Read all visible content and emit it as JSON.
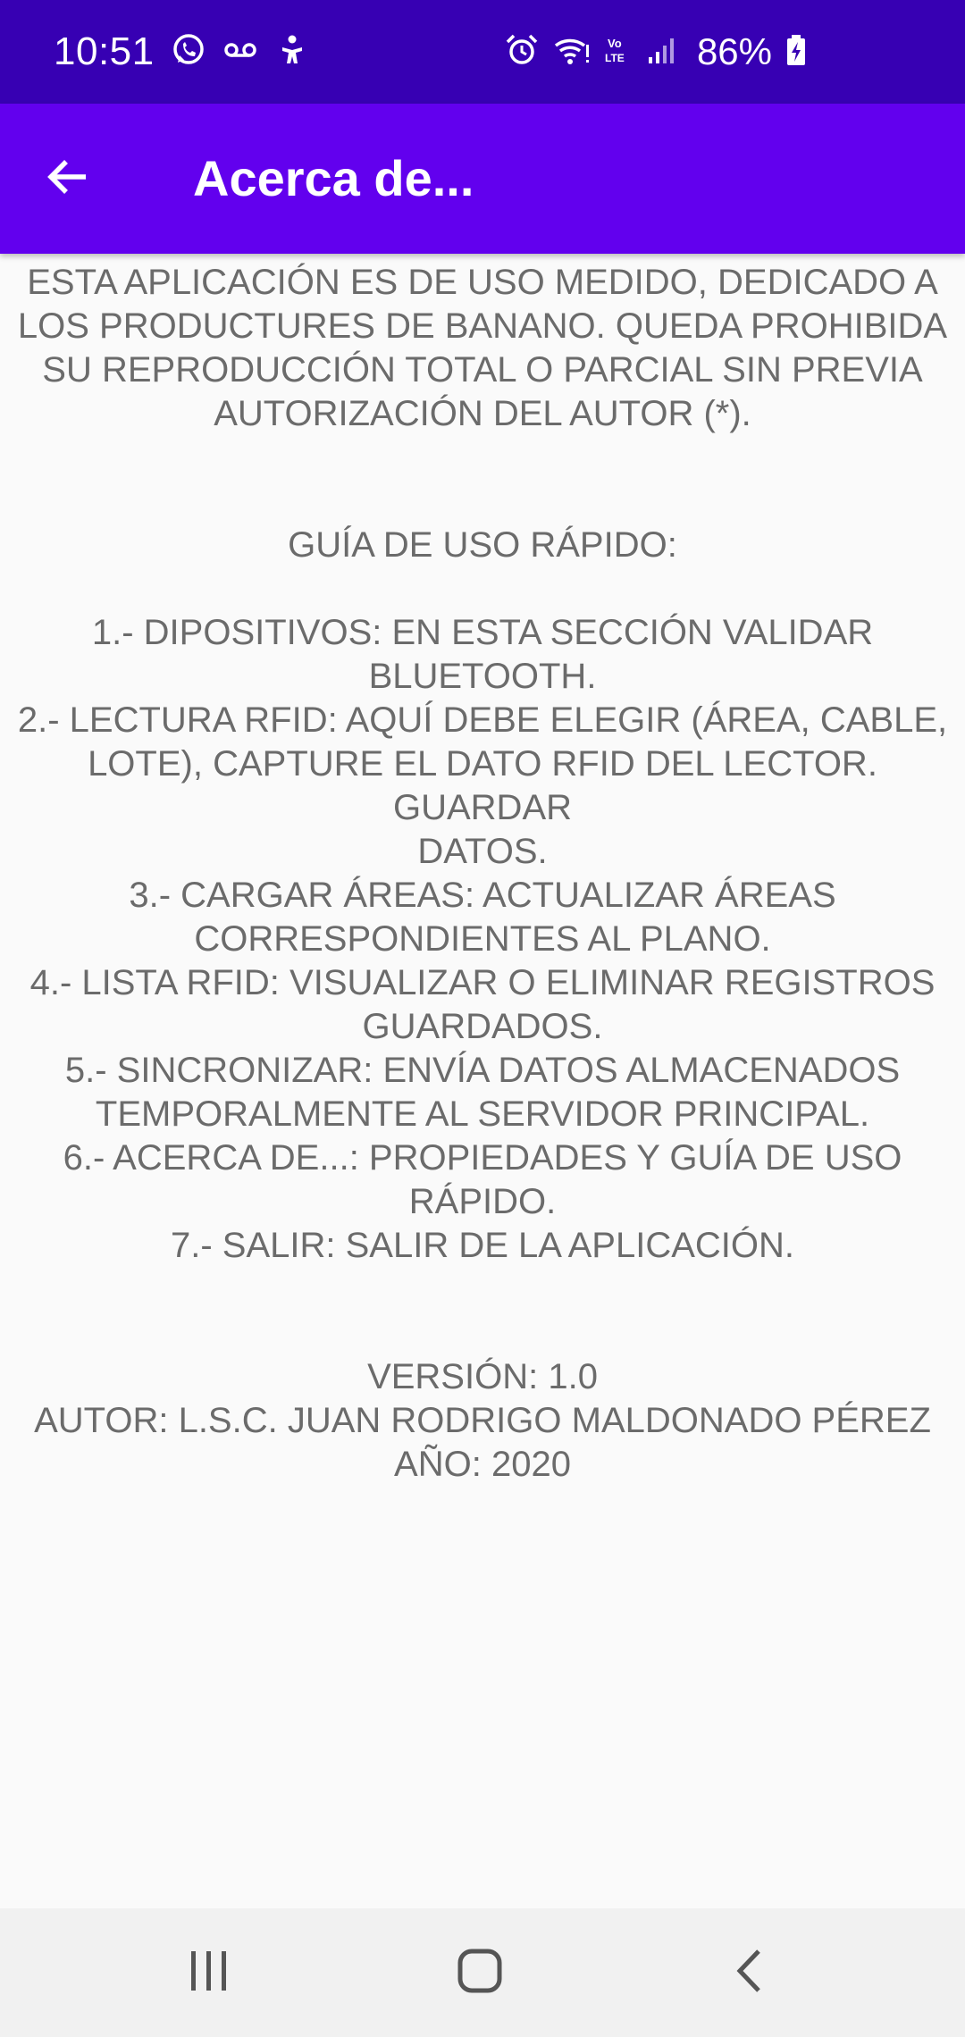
{
  "status_bar": {
    "time": "10:51",
    "battery": "86%",
    "icons_left": [
      "whatsapp-icon",
      "voicemail-icon",
      "accessibility-icon"
    ],
    "icons_right": [
      "alarm-icon",
      "wifi-icon",
      "volte-icon",
      "signal-icon",
      "battery-charging-icon"
    ]
  },
  "app_bar": {
    "title": "Acerca de...",
    "back_icon": "arrow-left-icon",
    "color": "#6200ee"
  },
  "content": {
    "disclaimer": "ESTA APLICACIÓN ES DE USO MEDIDO, DEDICADO A\nLOS PRODUCTURES DE BANANO. QUEDA PROHIBIDA\nSU REPRODUCCIÓN TOTAL O PARCIAL SIN PREVIA\nAUTORIZACIÓN DEL AUTOR (*).",
    "guide_title": "GUÍA DE USO RÁPIDO:",
    "guide_items": [
      "1.- DIPOSITIVOS: EN ESTA SECCIÓN VALIDAR\nBLUETOOTH.",
      "2.- LECTURA RFID: AQUÍ DEBE ELEGIR (ÁREA, CABLE,\nLOTE), CAPTURE EL DATO RFID DEL LECTOR. GUARDAR\nDATOS.",
      "3.- CARGAR ÁREAS: ACTUALIZAR ÁREAS\nCORRESPONDIENTES AL PLANO.",
      "4.- LISTA RFID: VISUALIZAR O ELIMINAR REGISTROS\nGUARDADOS.",
      "5.- SINCRONIZAR: ENVÍA DATOS ALMACENADOS\nTEMPORALMENTE AL SERVIDOR PRINCIPAL.",
      "6.- ACERCA DE...: PROPIEDADES Y GUÍA DE USO RÁPIDO.",
      "7.- SALIR: SALIR DE LA APLICACIÓN."
    ],
    "version": "VERSIÓN: 1.0",
    "author": "AUTOR: L.S.C. JUAN RODRIGO MALDONADO PÉREZ",
    "year": "AÑO: 2020"
  },
  "nav_bar": {
    "buttons": [
      "recents-icon",
      "home-icon",
      "back-icon"
    ]
  }
}
